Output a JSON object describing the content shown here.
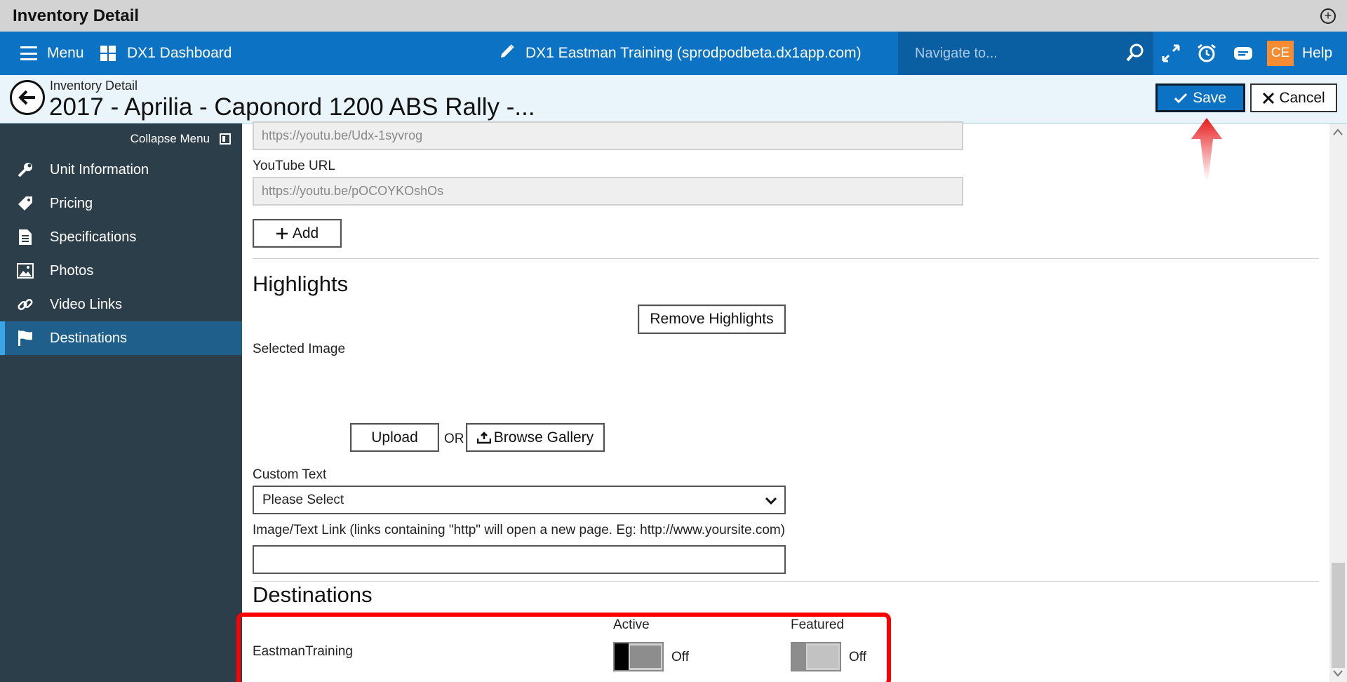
{
  "window": {
    "title": "Inventory Detail"
  },
  "topnav": {
    "menu_label": "Menu",
    "dashboard_label": "DX1 Dashboard",
    "site_label": "DX1 Eastman Training (sprodpodbeta.dx1app.com)",
    "search_placeholder": "Navigate to...",
    "avatar_initials": "CE",
    "help_label": "Help"
  },
  "header": {
    "breadcrumb": "Inventory Detail",
    "title": "2017 - Aprilia - Caponord 1200 ABS Rally -...",
    "save_label": "Save",
    "cancel_label": "Cancel"
  },
  "sidebar": {
    "collapse_label": "Collapse Menu",
    "items": [
      {
        "label": "Unit Information",
        "icon": "wrench-icon"
      },
      {
        "label": "Pricing",
        "icon": "tag-icon"
      },
      {
        "label": "Specifications",
        "icon": "document-icon"
      },
      {
        "label": "Photos",
        "icon": "image-icon"
      },
      {
        "label": "Video Links",
        "icon": "link-icon"
      },
      {
        "label": "Destinations",
        "icon": "flag-icon",
        "active": true
      }
    ]
  },
  "video_links": {
    "url_1_value": "https://youtu.be/Udx-1syvrog",
    "youtube_label": "YouTube URL",
    "url_2_value": "https://youtu.be/pOCOYKOshOs",
    "add_label": "Add"
  },
  "highlights": {
    "heading": "Highlights",
    "remove_label": "Remove Highlights",
    "selected_image_label": "Selected Image",
    "upload_label": "Upload",
    "or_label": "OR",
    "browse_label": "Browse Gallery",
    "custom_text_label": "Custom Text",
    "custom_text_value": "Please Select",
    "link_label": "Image/Text Link (links containing \"http\" will open a new page. Eg: http://www.yoursite.com)"
  },
  "destinations": {
    "heading": "Destinations",
    "active_label": "Active",
    "featured_label": "Featured",
    "rows": [
      {
        "name": "EastmanTraining",
        "active_state": "Off",
        "featured_state": "Off"
      }
    ]
  },
  "colors": {
    "nav_blue": "#0b72c4",
    "sidebar": "#2c3e4a",
    "annotation_red": "#ff0000",
    "avatar_orange": "#f58b32"
  }
}
